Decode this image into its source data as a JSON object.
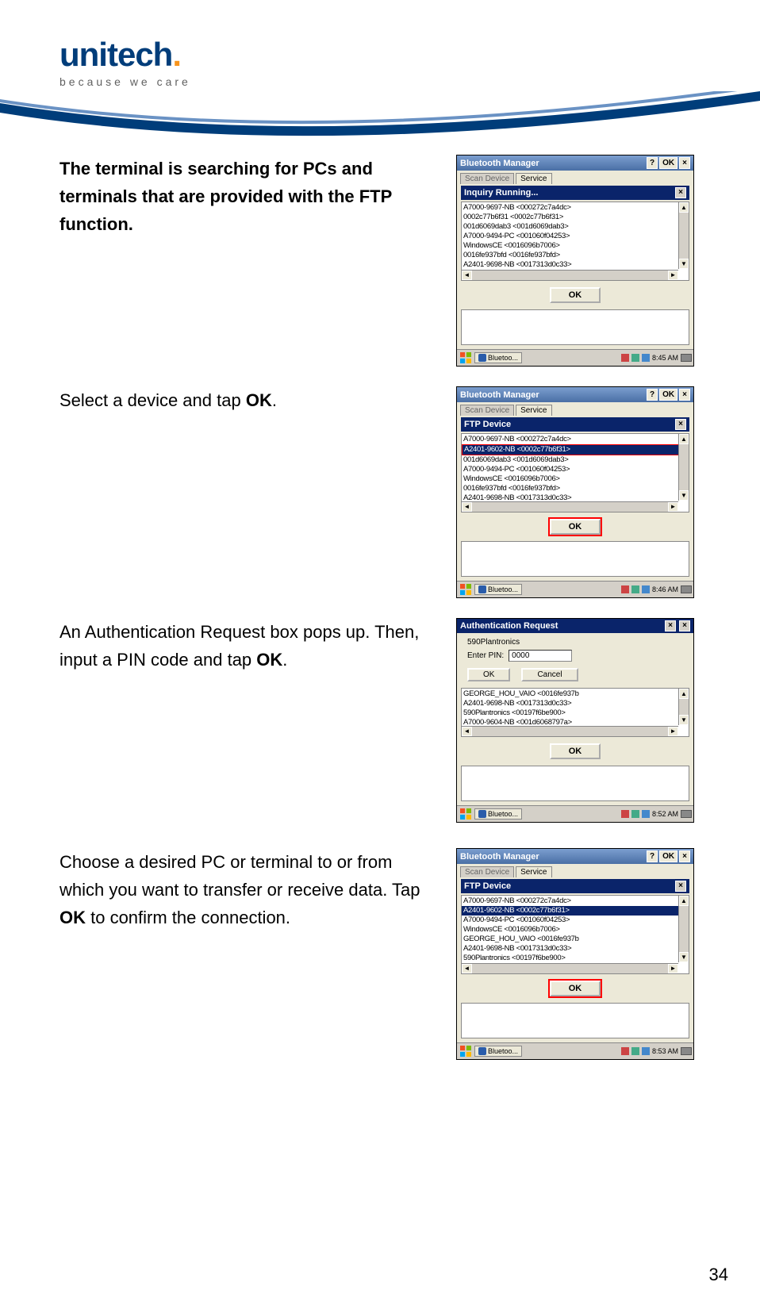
{
  "brand": {
    "name": "unitech",
    "tagline": "because we care"
  },
  "page_number": "34",
  "steps": {
    "s1": {
      "text_bold": "The terminal is searching for PCs and terminals that are provided with the FTP function."
    },
    "s2": {
      "prefix": "Select a device and tap ",
      "bold": "OK",
      "suffix": "."
    },
    "s3": {
      "prefix": "An Authentication Request box pops up. Then, input a PIN code and tap ",
      "bold": "OK",
      "suffix": "."
    },
    "s4": {
      "prefix": "Choose a desired PC or terminal to or from which you want to transfer or receive data. Tap ",
      "bold": "OK",
      "suffix": " to confirm the connection."
    }
  },
  "mock": {
    "bt_mgr_title": "Bluetooth Manager",
    "help_btn": "?",
    "ok_btn": "OK",
    "close_btn": "×",
    "tab_scan": "Scan Device",
    "tab_service": "Service",
    "inquiry_title": "Inquiry Running...",
    "ftp_device_title": "FTP Device",
    "auth_title": "Authentication Request",
    "devices_a": [
      "A7000-9697-NB <000272c7a4dc>",
      "0002c77b6f31 <0002c77b6f31>",
      "001d6069dab3 <001d6069dab3>",
      "A7000-9494-PC <001060f04253>",
      "WindowsCE <0016096b7006>",
      "0016fe937bfd <0016fe937bfd>",
      "A2401-9698-NB <0017313d0c33>",
      "A7000-9604-NB <001d6068797a>"
    ],
    "selected_device": "A2401-9602-NB <0002c77b6f31>",
    "devices_c": [
      "GEORGE_HOU_VAIO <0016fe937b",
      "A2401-9698-NB <0017313d0c33>",
      "590Plantronics <00197f6be900>",
      "A7000-9604-NB <001d6068797a>"
    ],
    "devices_d": [
      "A7000-9697-NB <000272c7a4dc>",
      "A2401-9602-NB <0002c77b6f31>",
      "A7000-9494-PC <001060f04253>",
      "WindowsCE <0016096b7006>",
      "GEORGE_HOU_VAIO <0016fe937b",
      "A2401-9698-NB <0017313d0c33>",
      "590Plantronics <00197f6be900>",
      "A7000-9604-NB <001d6068797a>"
    ],
    "ok_label": "OK",
    "cancel_label": "Cancel",
    "auth_device": "590Plantronics",
    "pin_label": "Enter PIN:",
    "pin_value": "0000",
    "taskbar_app": "Bluetoo...",
    "times": {
      "t1": "8:45 AM",
      "t2": "8:46 AM",
      "t3": "8:52 AM",
      "t4": "8:53 AM"
    }
  }
}
